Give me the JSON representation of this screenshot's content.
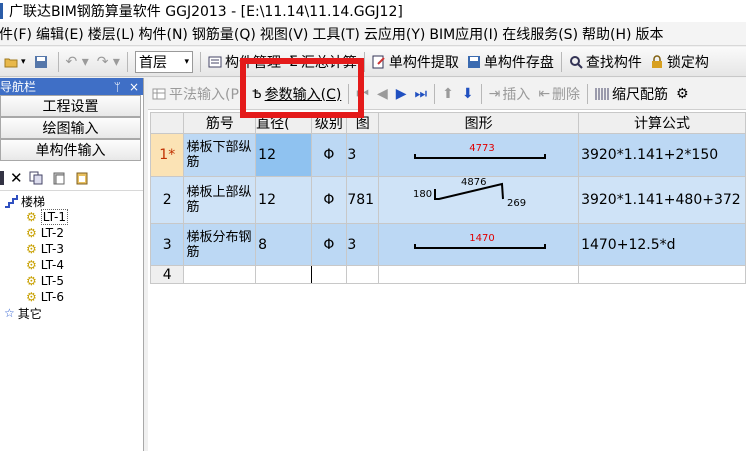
{
  "title": "广联达BIM钢筋算量软件 GGJ2013 - [E:\\11.14\\11.14.GGJ12]",
  "menu": [
    "件(F)",
    "编辑(E)",
    "楼层(L)",
    "构件(N)",
    "钢筋量(Q)",
    "视图(V)",
    "工具(T)",
    "云应用(Y)",
    "BIM应用(I)",
    "在线服务(S)",
    "帮助(H)",
    "版本"
  ],
  "toolbar": {
    "floor": "首层",
    "component_mgmt": "构件管理",
    "summary_calc": "汇总计算",
    "single_extract": "单构件提取",
    "single_save": "单构件存盘",
    "find_component": "查找构件",
    "lock_component": "锁定构"
  },
  "nav": {
    "title": "导航栏",
    "pin": "ᛘ",
    "close": "×",
    "buttons": [
      "工程设置",
      "绘图输入",
      "单构件输入"
    ],
    "tree_root": "楼梯",
    "tree_children": [
      "LT-1",
      "LT-2",
      "LT-3",
      "LT-4",
      "LT-5",
      "LT-6"
    ],
    "tree_other": "其它"
  },
  "subtoolbar": {
    "flat_input": "平法输入(P)",
    "param_input": "参数输入(C)",
    "insert": "插入",
    "delete": "删除",
    "scale_rebar": "缩尺配筋"
  },
  "grid": {
    "headers": [
      "筋号",
      "直径(",
      "级别",
      "图",
      "图形",
      "计算公式"
    ],
    "rows": [
      {
        "num": "1*",
        "name": "梯板下部纵筋",
        "dia": "12",
        "grade": "Φ",
        "shape": "3",
        "fig_len": "4773",
        "formula": "3920*1.141+2*150"
      },
      {
        "num": "2",
        "name": "梯板上部纵筋",
        "dia": "12",
        "grade": "Φ",
        "shape": "781",
        "fig_a": "180",
        "fig_b": "4876",
        "fig_c": "269",
        "formula": "3920*1.141+480+372"
      },
      {
        "num": "3",
        "name": "梯板分布钢筋",
        "dia": "8",
        "grade": "Φ",
        "shape": "3",
        "fig_len": "1470",
        "formula": "1470+12.5*d"
      },
      {
        "num": "4"
      }
    ]
  },
  "colors": {
    "highlight_box": "#e41a1a",
    "selected_row": "#bcd8f4",
    "nav_header": "#3f6fc6"
  }
}
